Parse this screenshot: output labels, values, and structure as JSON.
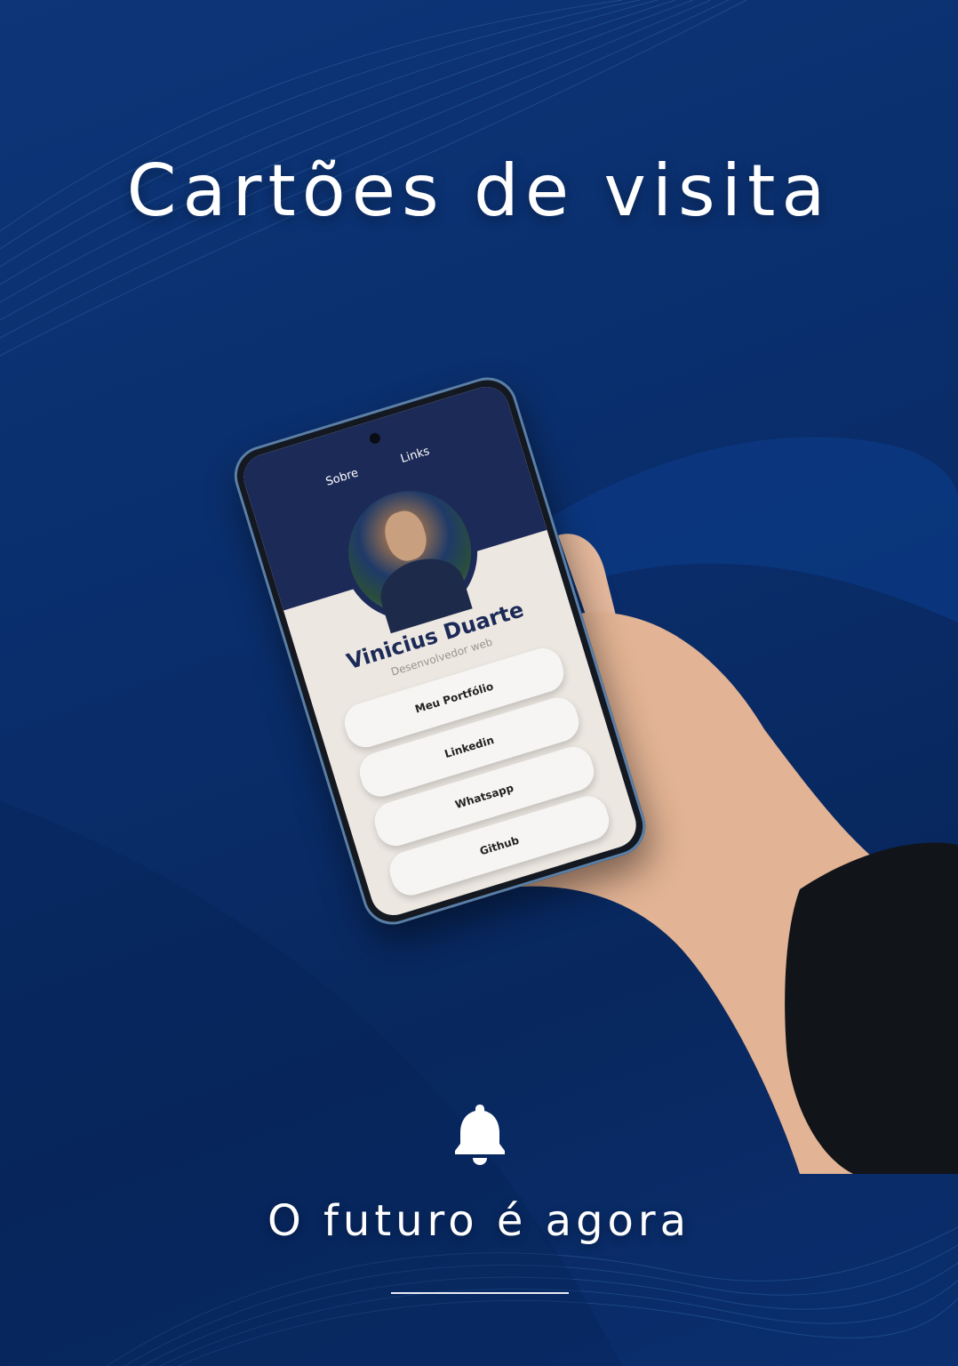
{
  "title": "Cartões de visita",
  "slogan": "O futuro é agora",
  "phone": {
    "nav": [
      "Sobre",
      "Links"
    ],
    "profile": {
      "name": "Vinicius Duarte",
      "role": "Desenvolvedor web"
    },
    "buttons": [
      "Meu Portfólio",
      "Linkedin",
      "Whatsapp",
      "Github"
    ]
  },
  "colors": {
    "background": "#0a2e6c",
    "phone_header": "#1c2a57",
    "card_bg": "#ece7e1",
    "text_light": "#ffffff"
  },
  "icons": [
    "bell-icon"
  ]
}
